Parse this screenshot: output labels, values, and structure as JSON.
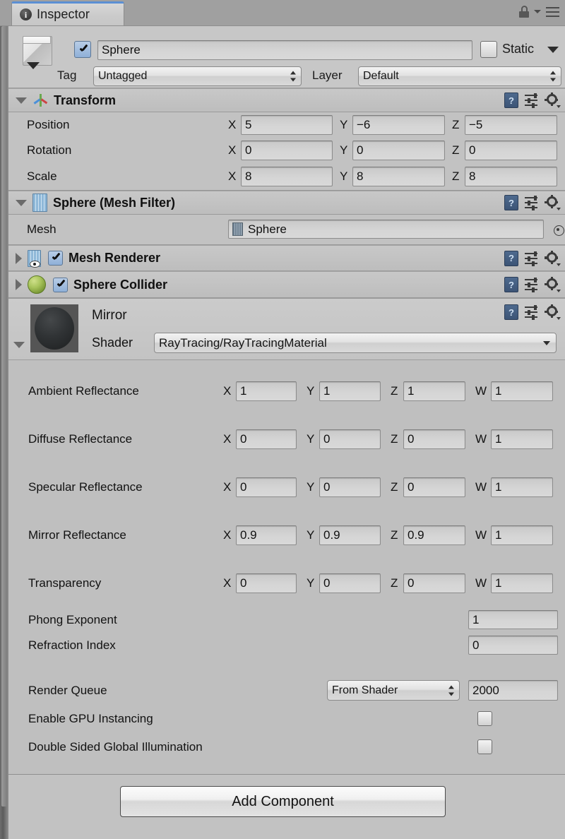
{
  "window": {
    "tab_label": "Inspector",
    "tab_icon": "info-icon",
    "lock_icon": "lock-icon",
    "menu_icon": "hamburger-menu-icon"
  },
  "object_header": {
    "icon": "cube-prefab-icon",
    "active_checked": true,
    "name_value": "Sphere",
    "static_label": "Static",
    "static_checked": false,
    "tag_label": "Tag",
    "tag_value": "Untagged",
    "layer_label": "Layer",
    "layer_value": "Default"
  },
  "components": [
    {
      "id": "transform",
      "title": "Transform",
      "icon": "transform-axis-icon",
      "expanded": true,
      "has_enable_checkbox": false,
      "rows": [
        {
          "label": "Position",
          "fields": [
            {
              "axis": "X",
              "value": "5"
            },
            {
              "axis": "Y",
              "value": "−6"
            },
            {
              "axis": "Z",
              "value": "−5"
            }
          ]
        },
        {
          "label": "Rotation",
          "fields": [
            {
              "axis": "X",
              "value": "0"
            },
            {
              "axis": "Y",
              "value": "0"
            },
            {
              "axis": "Z",
              "value": "0"
            }
          ]
        },
        {
          "label": "Scale",
          "fields": [
            {
              "axis": "X",
              "value": "8"
            },
            {
              "axis": "Y",
              "value": "8"
            },
            {
              "axis": "Z",
              "value": "8"
            }
          ]
        }
      ]
    },
    {
      "id": "mesh-filter",
      "title": "Sphere (Mesh Filter)",
      "icon": "mesh-filter-icon",
      "expanded": true,
      "has_enable_checkbox": false,
      "mesh_label": "Mesh",
      "mesh_value": "Sphere",
      "mesh_object_icon": "mesh-asset-icon",
      "mesh_picker_icon": "object-picker-icon"
    },
    {
      "id": "mesh-renderer",
      "title": "Mesh Renderer",
      "icon": "mesh-renderer-icon",
      "expanded": false,
      "has_enable_checkbox": true,
      "enabled": true
    },
    {
      "id": "sphere-collider",
      "title": "Sphere Collider",
      "icon": "sphere-collider-icon",
      "expanded": false,
      "has_enable_checkbox": true,
      "enabled": true
    }
  ],
  "material": {
    "preview_icon": "material-sphere-preview",
    "name": "Mirror",
    "shader_label": "Shader",
    "shader_value": "RayTracing/RayTracingMaterial",
    "expanded": true,
    "vector_properties": [
      {
        "label": "Ambient Reflectance",
        "fields": [
          {
            "axis": "X",
            "value": "1"
          },
          {
            "axis": "Y",
            "value": "1"
          },
          {
            "axis": "Z",
            "value": "1"
          },
          {
            "axis": "W",
            "value": "1"
          }
        ]
      },
      {
        "label": "Diffuse Reflectance",
        "fields": [
          {
            "axis": "X",
            "value": "0"
          },
          {
            "axis": "Y",
            "value": "0"
          },
          {
            "axis": "Z",
            "value": "0"
          },
          {
            "axis": "W",
            "value": "1"
          }
        ]
      },
      {
        "label": "Specular Reflectance",
        "fields": [
          {
            "axis": "X",
            "value": "0"
          },
          {
            "axis": "Y",
            "value": "0"
          },
          {
            "axis": "Z",
            "value": "0"
          },
          {
            "axis": "W",
            "value": "1"
          }
        ]
      },
      {
        "label": "Mirror Reflectance",
        "fields": [
          {
            "axis": "X",
            "value": "0.9"
          },
          {
            "axis": "Y",
            "value": "0.9"
          },
          {
            "axis": "Z",
            "value": "0.9"
          },
          {
            "axis": "W",
            "value": "1"
          }
        ]
      },
      {
        "label": "Transparency",
        "fields": [
          {
            "axis": "X",
            "value": "0"
          },
          {
            "axis": "Y",
            "value": "0"
          },
          {
            "axis": "Z",
            "value": "0"
          },
          {
            "axis": "W",
            "value": "1"
          }
        ]
      }
    ],
    "scalar_properties": [
      {
        "label": "Phong Exponent",
        "value": "1"
      },
      {
        "label": "Refraction Index",
        "value": "0"
      }
    ],
    "render_queue_label": "Render Queue",
    "render_queue_mode": "From Shader",
    "render_queue_value": "2000",
    "gpu_instancing_label": "Enable GPU Instancing",
    "gpu_instancing_checked": false,
    "double_sided_gi_label": "Double Sided Global Illumination",
    "double_sided_gi_checked": false
  },
  "footer": {
    "add_component_label": "Add Component"
  },
  "colors": {
    "panel_bg": "#c2c2c2",
    "chrome_bg": "#a0a0a0",
    "tab_accent": "#5b8fd4",
    "header_bg": "#c8c8c8",
    "field_bg": "#d6d6d6",
    "checkbox_checked": "#8fb0d8",
    "collider_icon": "#8db04a"
  }
}
